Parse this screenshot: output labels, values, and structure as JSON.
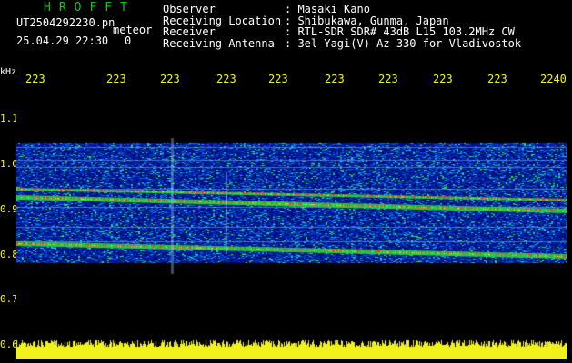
{
  "header": {
    "brand": "HROFFT",
    "filename": "UT2504292230.pn",
    "mode": "meteor",
    "date": "25.04.29 22:30",
    "count": "0",
    "fields": [
      {
        "label": "Observer",
        "value": ": Masaki Kano"
      },
      {
        "label": "Receiving Location",
        "value": ": Shibukawa, Gunma, Japan"
      },
      {
        "label": "Receiver",
        "value": ": RTL-SDR SDR# 43dB L15 103.2MHz CW"
      },
      {
        "label": "Receiving Antenna",
        "value": ": 3el Yagi(V) Az 330 for Vladivostok"
      }
    ]
  },
  "axis": {
    "unit": "kHz",
    "x_ticks": [
      "223",
      "223",
      "223",
      "223",
      "223",
      "223",
      "223",
      "223",
      "223",
      "2240"
    ],
    "y_ticks": [
      "1.1",
      "1.0",
      "0.9",
      "0.8",
      "0.7",
      "0.6"
    ]
  },
  "colors": {
    "brand": "#12c31a",
    "tick": "#f2f21b",
    "background": "#000000",
    "spectrum_base": "#000a7a",
    "signal": "#ff2020",
    "noise_bar": "#f2f21b"
  }
}
